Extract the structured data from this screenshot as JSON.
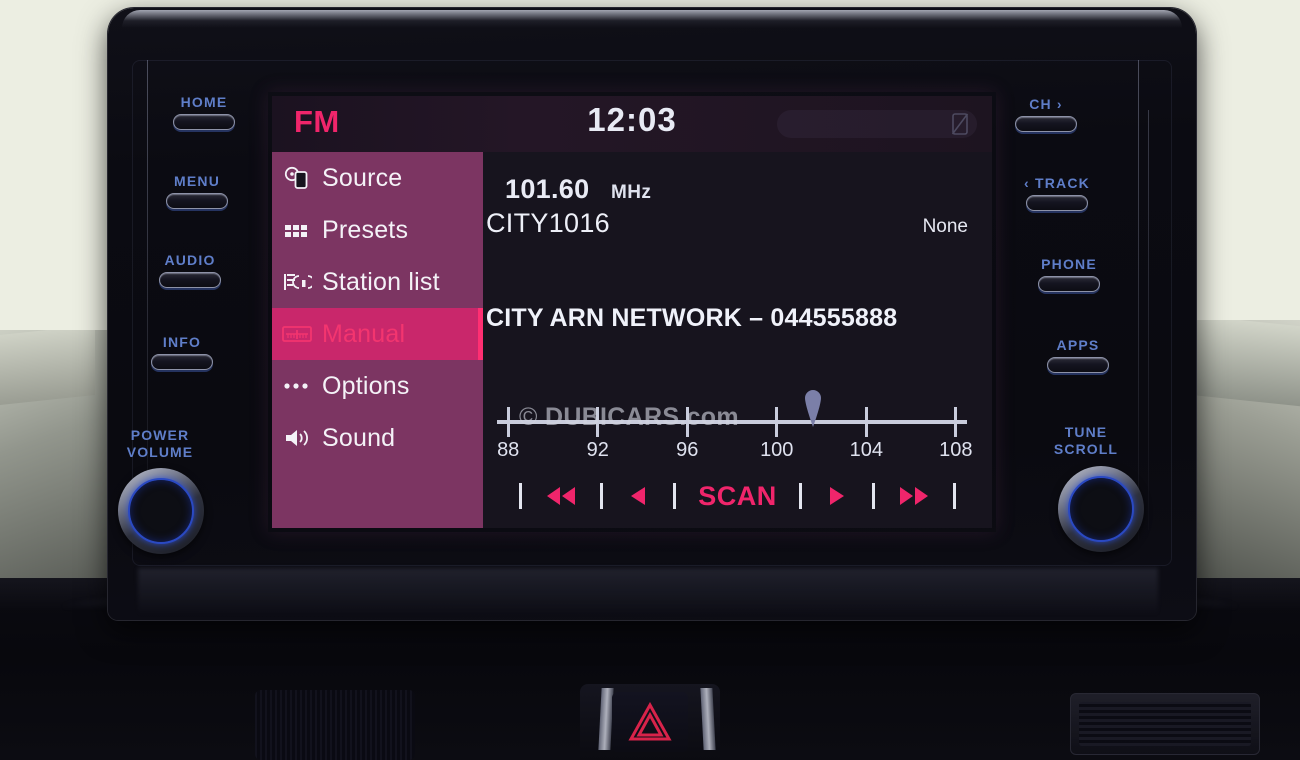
{
  "screen": {
    "status": {
      "source_label": "FM",
      "clock": "12:03",
      "mute_icon": "phone-muted-icon"
    },
    "sidebar": {
      "items": [
        {
          "label": "Source",
          "icon": "disc-device-icon",
          "selected": false
        },
        {
          "label": "Presets",
          "icon": "grid-dots-icon",
          "selected": false
        },
        {
          "label": "Station list",
          "icon": "antenna-list-icon",
          "selected": false
        },
        {
          "label": "Manual",
          "icon": "tuning-ruler-icon",
          "selected": true
        },
        {
          "label": "Options",
          "icon": "ellipsis-icon",
          "selected": false
        },
        {
          "label": "Sound",
          "icon": "speaker-icon",
          "selected": false
        }
      ]
    },
    "now_playing": {
      "frequency": "101.60",
      "frequency_unit": "MHz",
      "station_id": "CITY1016",
      "right_status": "None",
      "radio_text": "CITY ARN NETWORK – 044555888"
    },
    "watermark": {
      "copyright": "©",
      "text": "DUBICARS.com"
    },
    "tuning_scale": {
      "min": 87.5,
      "max": 108.5,
      "current": 101.6,
      "ticks": [
        "88",
        "92",
        "96",
        "100",
        "104",
        "108"
      ],
      "tick_values": [
        88,
        92,
        96,
        100,
        104,
        108
      ]
    },
    "controls": [
      {
        "name": "rewind",
        "label": "◀◀",
        "type": "icon"
      },
      {
        "name": "previous",
        "label": "◀",
        "type": "icon"
      },
      {
        "name": "scan",
        "label": "SCAN",
        "type": "text"
      },
      {
        "name": "next",
        "label": "▶",
        "type": "icon"
      },
      {
        "name": "fast-forward",
        "label": "▶▶",
        "type": "icon"
      }
    ],
    "colors": {
      "accent_pink": "#f0256b",
      "sidebar_purple": "#7c3562",
      "selected_magenta": "#c9276b",
      "selected_bar": "#ff2f72",
      "screen_bg": "#17141e"
    }
  },
  "hard_buttons": {
    "left": [
      {
        "label": "HOME"
      },
      {
        "label": "MENU"
      },
      {
        "label": "AUDIO"
      },
      {
        "label": "INFO"
      }
    ],
    "right": [
      {
        "label": "CH ›"
      },
      {
        "label": "‹ TRACK"
      },
      {
        "label": "PHONE"
      },
      {
        "label": "APPS"
      }
    ],
    "left_knob": {
      "line1": "POWER",
      "line2": "VOLUME"
    },
    "right_knob": {
      "line1": "TUNE",
      "line2": "SCROLL"
    }
  }
}
